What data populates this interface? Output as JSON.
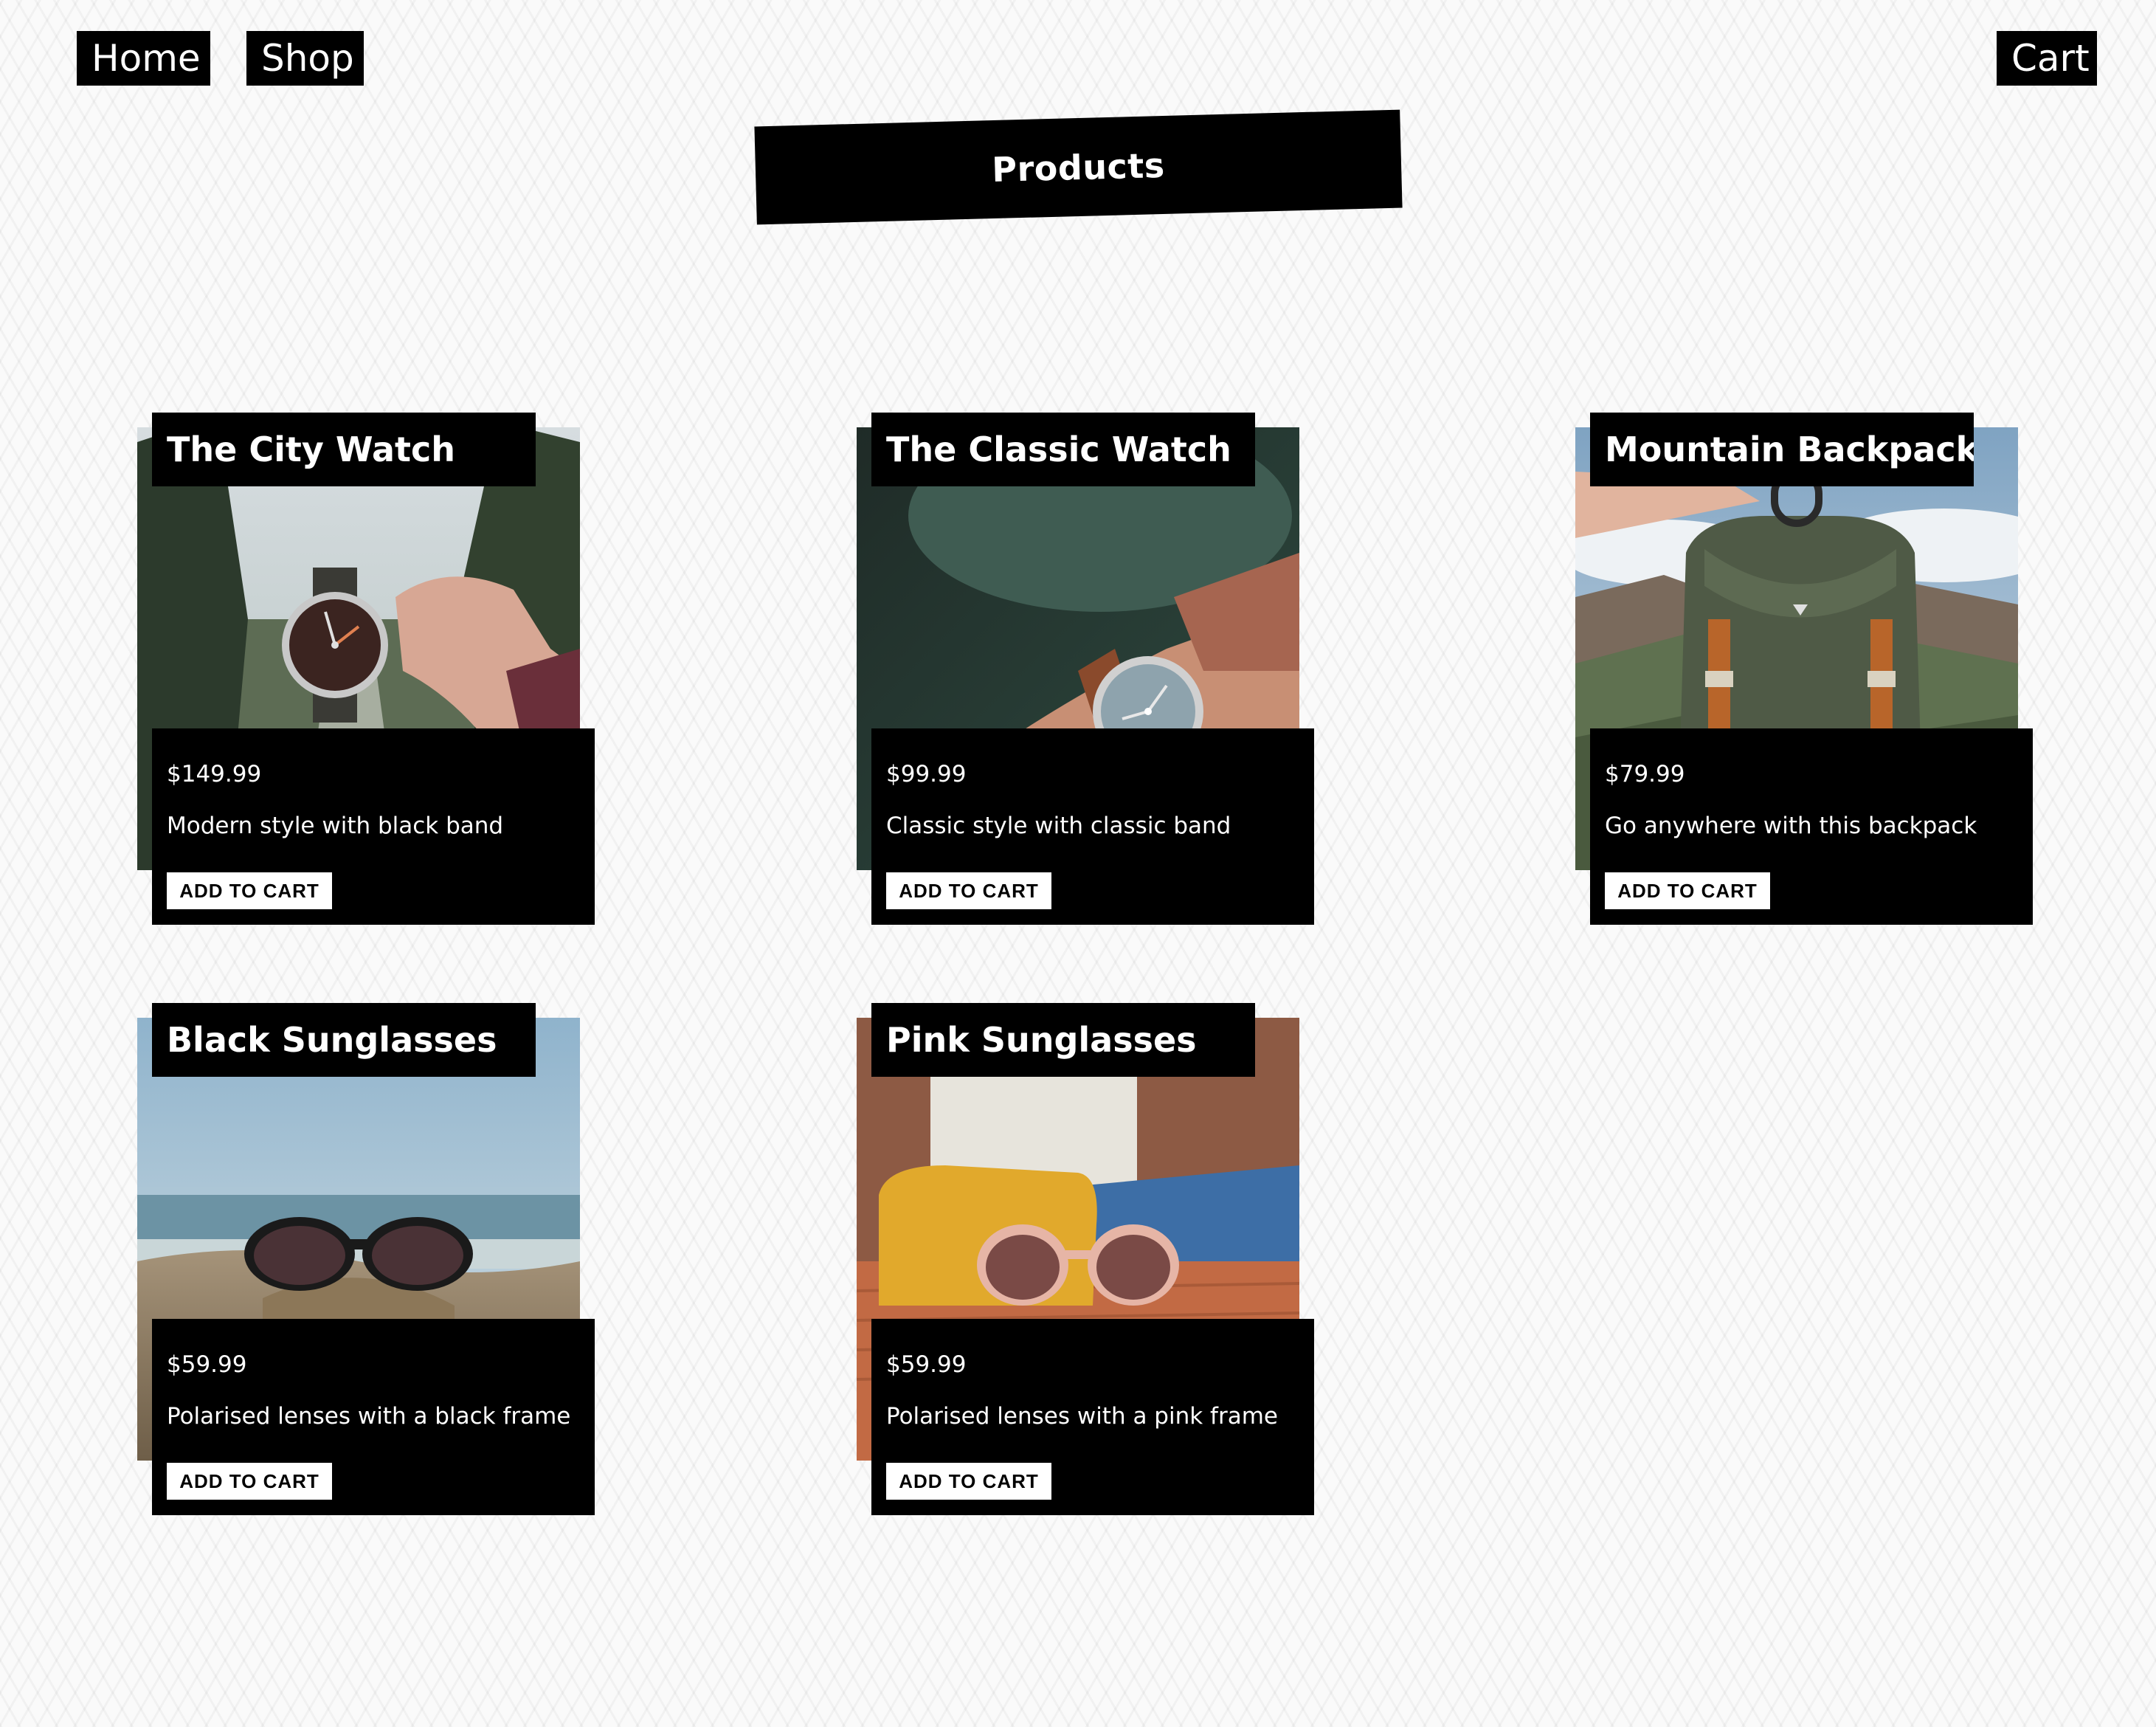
{
  "nav": {
    "home": "Home",
    "shop": "Shop",
    "cart": "Cart"
  },
  "page": {
    "title": "Products"
  },
  "products": [
    {
      "name": "The City Watch",
      "price": "$149.99",
      "description": "Modern style with black band",
      "button": "ADD TO CART",
      "image_icon": "watch-photo"
    },
    {
      "name": "The Classic Watch",
      "price": "$99.99",
      "description": "Classic style with classic band",
      "button": "ADD TO CART",
      "image_icon": "watch-photo"
    },
    {
      "name": "Mountain Backpack",
      "price": "$79.99",
      "description": "Go anywhere with this backpack",
      "button": "ADD TO CART",
      "image_icon": "backpack-photo"
    },
    {
      "name": "Black Sunglasses",
      "price": "$59.99",
      "description": "Polarised lenses with a black frame",
      "button": "ADD TO CART",
      "image_icon": "sunglasses-photo"
    },
    {
      "name": "Pink Sunglasses",
      "price": "$59.99",
      "description": "Polarised lenses with a pink frame",
      "button": "ADD TO CART",
      "image_icon": "sunglasses-photo"
    }
  ],
  "colors": {
    "panel": "#000000",
    "panel_text": "#ffffff",
    "button_bg": "#ffffff",
    "button_text": "#000000",
    "background": "#fafafa"
  }
}
